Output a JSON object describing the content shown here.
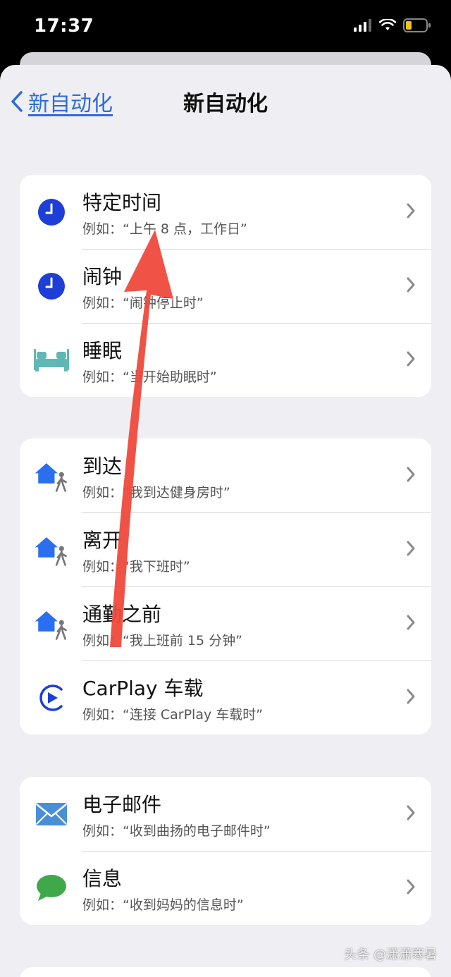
{
  "status": {
    "time": "17:37"
  },
  "nav": {
    "back_label": "新自动化",
    "title": "新自动化"
  },
  "groups": [
    {
      "items": [
        {
          "title": "特定时间",
          "subtitle": "例如：“上午 8 点，工作日”",
          "icon": "clock-icon"
        },
        {
          "title": "闹钟",
          "subtitle": "例如：“闹钟停止时”",
          "icon": "clock-icon"
        },
        {
          "title": "睡眠",
          "subtitle": "例如：“当开始助眠时”",
          "icon": "bed-icon"
        }
      ]
    },
    {
      "items": [
        {
          "title": "到达",
          "subtitle": "例如：“我到达健身房时”",
          "icon": "home-person-icon"
        },
        {
          "title": "离开",
          "subtitle": "例如：“我下班时”",
          "icon": "home-person-icon"
        },
        {
          "title": "通勤之前",
          "subtitle": "例如：“我上班前 15 分钟”",
          "icon": "home-person-icon"
        },
        {
          "title": "CarPlay 车载",
          "subtitle": "例如：“连接 CarPlay 车载时”",
          "icon": "carplay-icon"
        }
      ]
    },
    {
      "items": [
        {
          "title": "电子邮件",
          "subtitle": "例如：“收到曲扬的电子邮件时”",
          "icon": "mail-icon"
        },
        {
          "title": "信息",
          "subtitle": "例如：“收到妈妈的信息时”",
          "icon": "message-icon"
        }
      ]
    }
  ],
  "watermark": "头条 @潇潇寒暑",
  "colors": {
    "accent": "#2f6bd8",
    "clock": "#1d3fd8",
    "bed": "#5fb8b4",
    "home": "#2a6ff0",
    "mail": "#4a8fd6",
    "message": "#3fa94a",
    "arrow": "#ef4a3c"
  }
}
